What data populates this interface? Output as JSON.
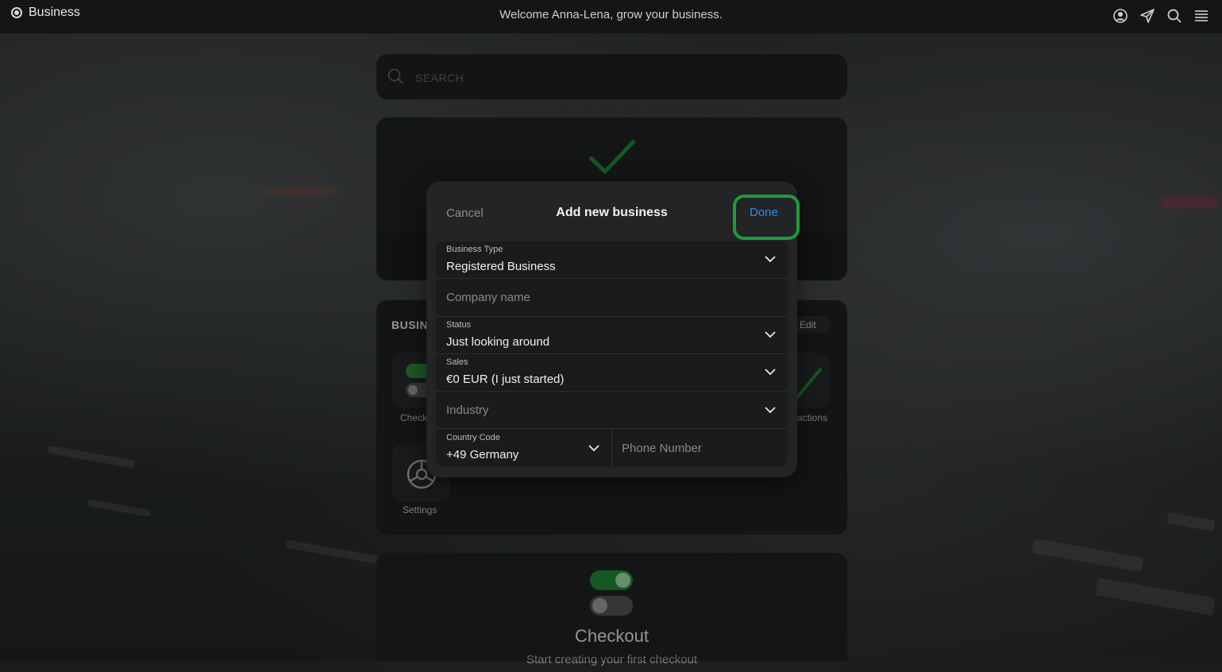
{
  "topbar": {
    "app_name": "Business",
    "welcome": "Welcome Anna-Lena, grow your business.",
    "icons": [
      "account-icon",
      "send-icon",
      "search-icon",
      "menu-icon"
    ]
  },
  "search": {
    "placeholder": "SEARCH"
  },
  "business_section": {
    "title": "BUSIN",
    "edit_label": "Edit",
    "tile_checkout_label": "Check",
    "tile_transactions_label": "actions",
    "tile_settings_label": "Settings"
  },
  "checkout_card": {
    "title": "Checkout",
    "subtitle": "Start creating your first checkout"
  },
  "modal": {
    "cancel_label": "Cancel",
    "title": "Add new business",
    "done_label": "Done",
    "fields": {
      "business_type": {
        "label": "Business Type",
        "value": "Registered Business"
      },
      "company_name": {
        "placeholder": "Company name"
      },
      "status": {
        "label": "Status",
        "value": "Just looking around"
      },
      "sales": {
        "label": "Sales",
        "value": "€0 EUR (I just started)"
      },
      "industry": {
        "placeholder": "Industry"
      },
      "country_code": {
        "label": "Country Code",
        "value": "+49 Germany"
      },
      "phone_number": {
        "placeholder": "Phone Number"
      }
    }
  },
  "colors": {
    "accent_green": "#1f9a3e",
    "link_blue": "#2f8de4",
    "modal_bg": "#222425"
  }
}
